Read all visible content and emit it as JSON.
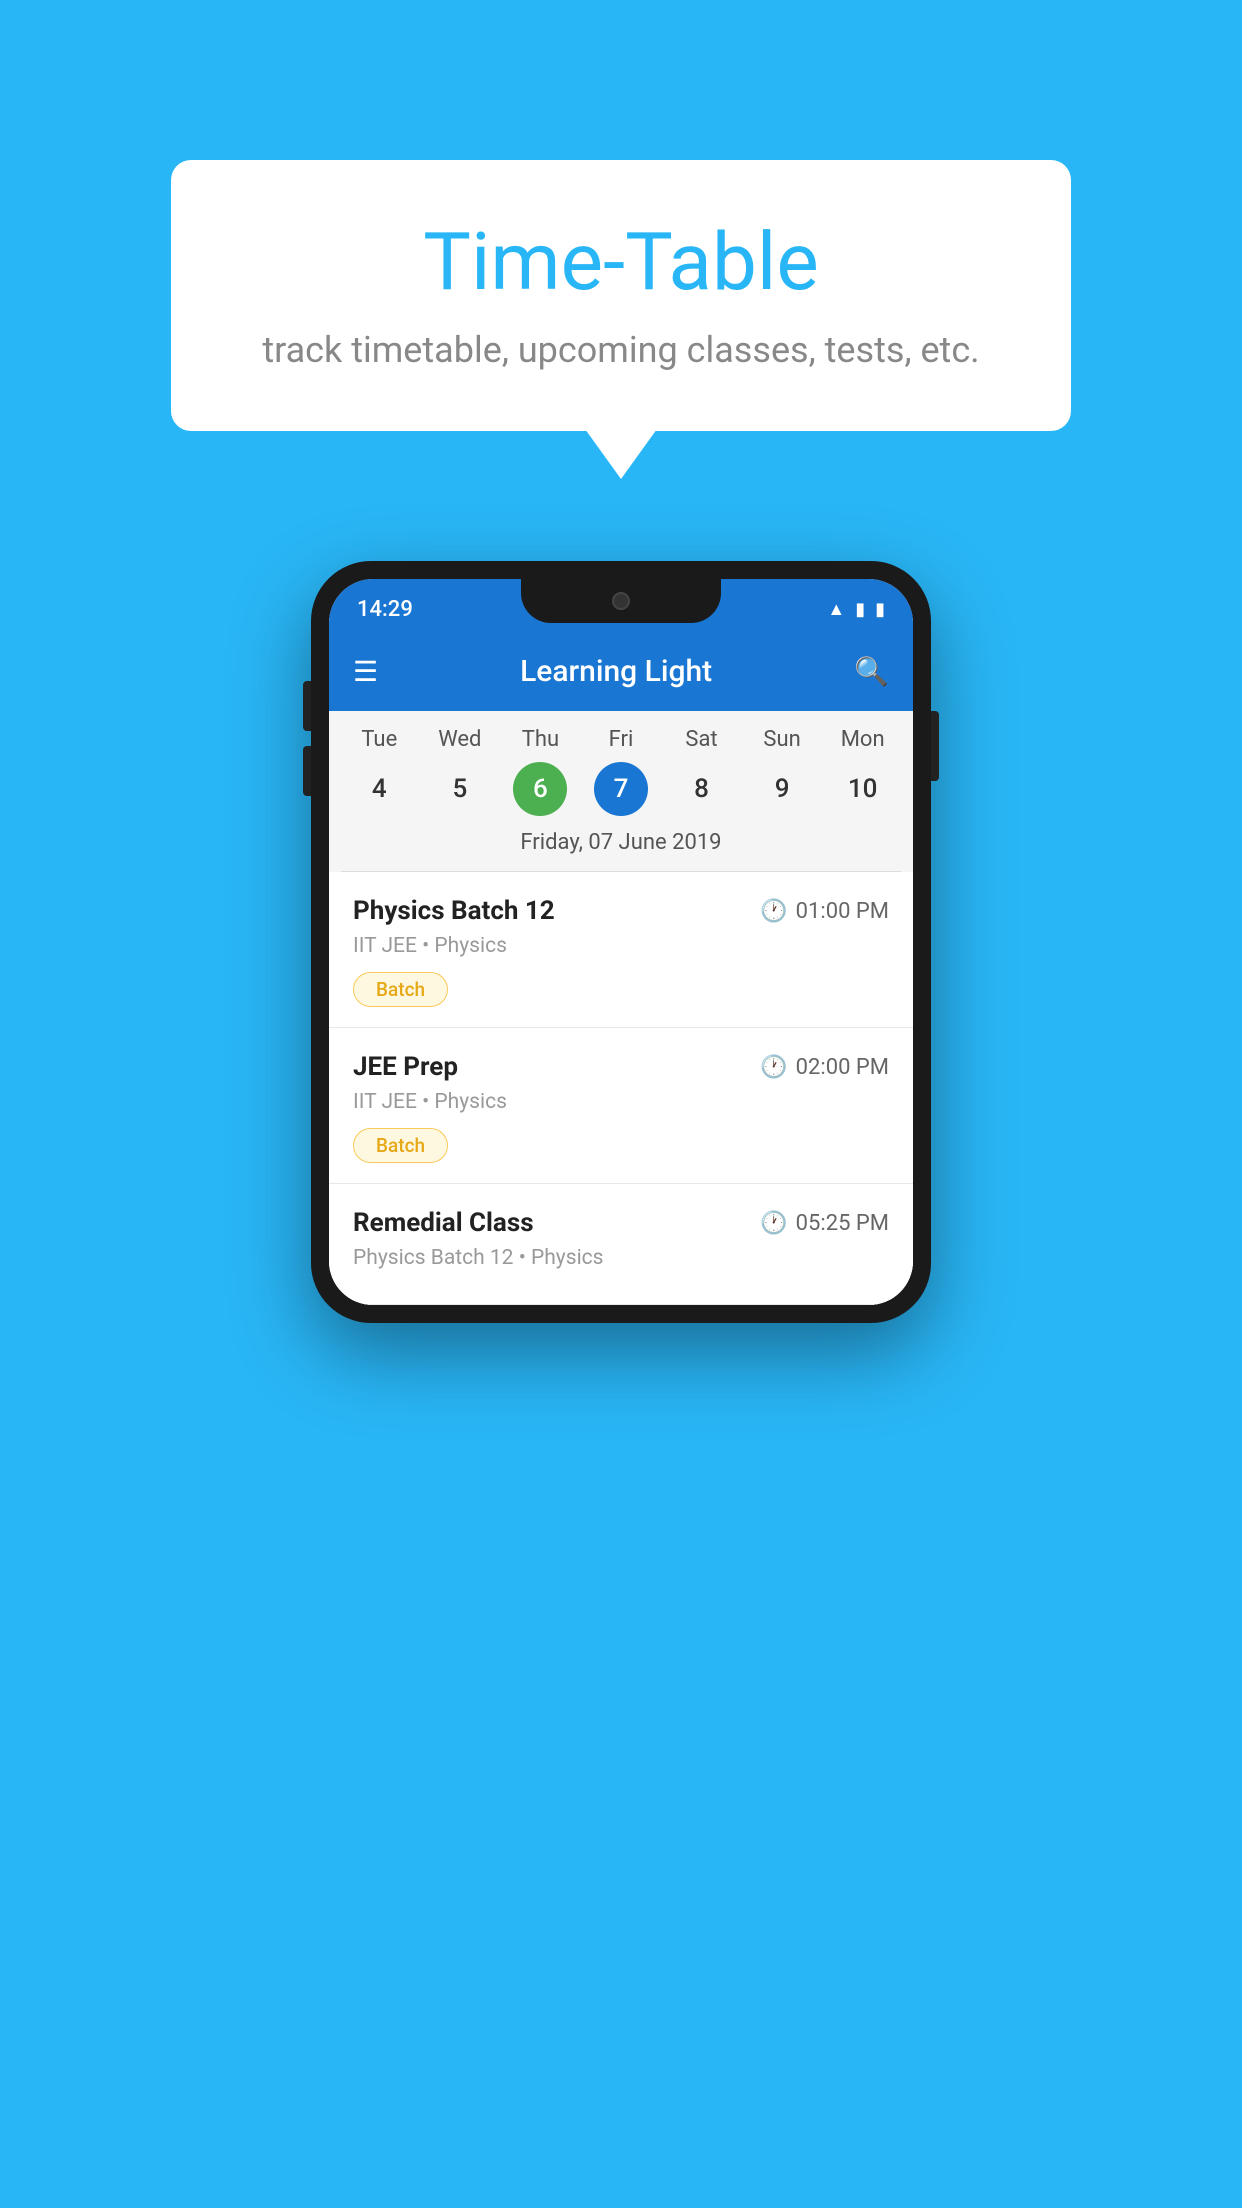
{
  "background_color": "#29B6F6",
  "bubble": {
    "title": "Time-Table",
    "subtitle": "track timetable, upcoming classes, tests, etc."
  },
  "phone": {
    "status_bar": {
      "time": "14:29"
    },
    "app_bar": {
      "title": "Learning Light"
    },
    "calendar": {
      "days": [
        {
          "name": "Tue",
          "number": "4",
          "state": "normal"
        },
        {
          "name": "Wed",
          "number": "5",
          "state": "normal"
        },
        {
          "name": "Thu",
          "number": "6",
          "state": "today"
        },
        {
          "name": "Fri",
          "number": "7",
          "state": "selected"
        },
        {
          "name": "Sat",
          "number": "8",
          "state": "normal"
        },
        {
          "name": "Sun",
          "number": "9",
          "state": "normal"
        },
        {
          "name": "Mon",
          "number": "10",
          "state": "normal"
        }
      ],
      "selected_date_label": "Friday, 07 June 2019"
    },
    "schedule": [
      {
        "title": "Physics Batch 12",
        "time": "01:00 PM",
        "meta": "IIT JEE • Physics",
        "badge": "Batch"
      },
      {
        "title": "JEE Prep",
        "time": "02:00 PM",
        "meta": "IIT JEE • Physics",
        "badge": "Batch"
      },
      {
        "title": "Remedial Class",
        "time": "05:25 PM",
        "meta": "Physics Batch 12 • Physics",
        "badge": null
      }
    ]
  }
}
